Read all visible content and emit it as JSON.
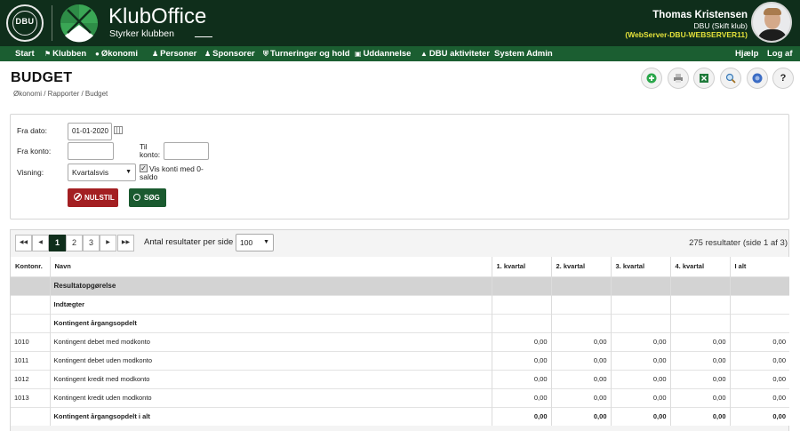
{
  "header": {
    "seal_text": "DBU",
    "app_name": "KlubOffice",
    "tagline": "Styrker klubben",
    "user_name": "Thomas Kristensen",
    "user_club": "DBU (Skift klub)",
    "user_server": "(WebServer-DBU-WEBSERVER11)"
  },
  "nav": {
    "items": [
      {
        "label": "Start",
        "icon": ""
      },
      {
        "label": "Klubben",
        "icon": "group-icon"
      },
      {
        "label": "Økonomi",
        "icon": "coin-icon"
      },
      {
        "label": "Personer",
        "icon": "person-icon"
      },
      {
        "label": "Sponsorer",
        "icon": "people-icon"
      },
      {
        "label": "Turneringer og hold",
        "icon": "shield-icon"
      },
      {
        "label": "Uddannelse",
        "icon": "screen-icon"
      },
      {
        "label": "DBU aktiviteter",
        "icon": "graduation-cap-icon"
      },
      {
        "label": "System Admin",
        "icon": ""
      }
    ],
    "help": "Hjælp",
    "logout": "Log af"
  },
  "page": {
    "title": "BUDGET",
    "breadcrumb": "Økonomi / Rapporter / Budget"
  },
  "toolbar": {
    "icons": [
      "add-icon",
      "print-icon",
      "excel-icon",
      "zoom-icon",
      "info-icon",
      "help-icon"
    ],
    "help_glyph": "?"
  },
  "filter": {
    "fra_dato_label": "Fra dato:",
    "fra_dato_value": "01-01-2020",
    "fra_konto_label": "Fra konto:",
    "fra_konto_value": "",
    "til_konto_label_1": "Til",
    "til_konto_label_2": "konto:",
    "til_konto_value": "",
    "visning_label": "Visning:",
    "visning_value": "Kvartalsvis",
    "vis_konti_label_1": "Vis konti med 0-",
    "vis_konti_label_2": "saldo",
    "vis_konti_checked": true,
    "reset_label": "NULSTIL",
    "search_label": "SØG"
  },
  "pagination": {
    "pages": [
      "1",
      "2",
      "3"
    ],
    "current": "1",
    "per_page_label": "Antal resultater per side",
    "per_page_value": "100",
    "results_text": "275 resultater (side 1 af 3)"
  },
  "table": {
    "columns": [
      "Kontonr.",
      "Navn",
      "1. kvartal",
      "2. kvartal",
      "3. kvartal",
      "4. kvartal",
      "I alt"
    ],
    "rows": [
      {
        "type": "group",
        "konto": "",
        "navn": "Resultatopgørelse",
        "q1": "",
        "q2": "",
        "q3": "",
        "q4": "",
        "total": ""
      },
      {
        "type": "bold",
        "konto": "",
        "navn": "Indtægter",
        "q1": "",
        "q2": "",
        "q3": "",
        "q4": "",
        "total": ""
      },
      {
        "type": "bold",
        "konto": "",
        "navn": "Kontingent årgangsopdelt",
        "q1": "",
        "q2": "",
        "q3": "",
        "q4": "",
        "total": ""
      },
      {
        "type": "normal",
        "konto": "1010",
        "navn": "Kontingent debet med modkonto",
        "q1": "0,00",
        "q2": "0,00",
        "q3": "0,00",
        "q4": "0,00",
        "total": "0,00"
      },
      {
        "type": "normal",
        "konto": "1011",
        "navn": "Kontingent debet uden modkonto",
        "q1": "0,00",
        "q2": "0,00",
        "q3": "0,00",
        "q4": "0,00",
        "total": "0,00"
      },
      {
        "type": "normal",
        "konto": "1012",
        "navn": "Kontingent kredit med modkonto",
        "q1": "0,00",
        "q2": "0,00",
        "q3": "0,00",
        "q4": "0,00",
        "total": "0,00"
      },
      {
        "type": "normal",
        "konto": "1013",
        "navn": "Kontingent kredit uden modkonto",
        "q1": "0,00",
        "q2": "0,00",
        "q3": "0,00",
        "q4": "0,00",
        "total": "0,00"
      },
      {
        "type": "bold",
        "konto": "",
        "navn": "Kontingent årgangsopdelt i alt",
        "q1": "0,00",
        "q2": "0,00",
        "q3": "0,00",
        "q4": "0,00",
        "total": "0,00"
      }
    ]
  },
  "colors": {
    "header_bg": "#0f2e1b",
    "nav_bg": "#1b5e31",
    "reset_button": "#a31f22",
    "search_button": "#1a5a2f",
    "server_text": "#e4e13a"
  }
}
